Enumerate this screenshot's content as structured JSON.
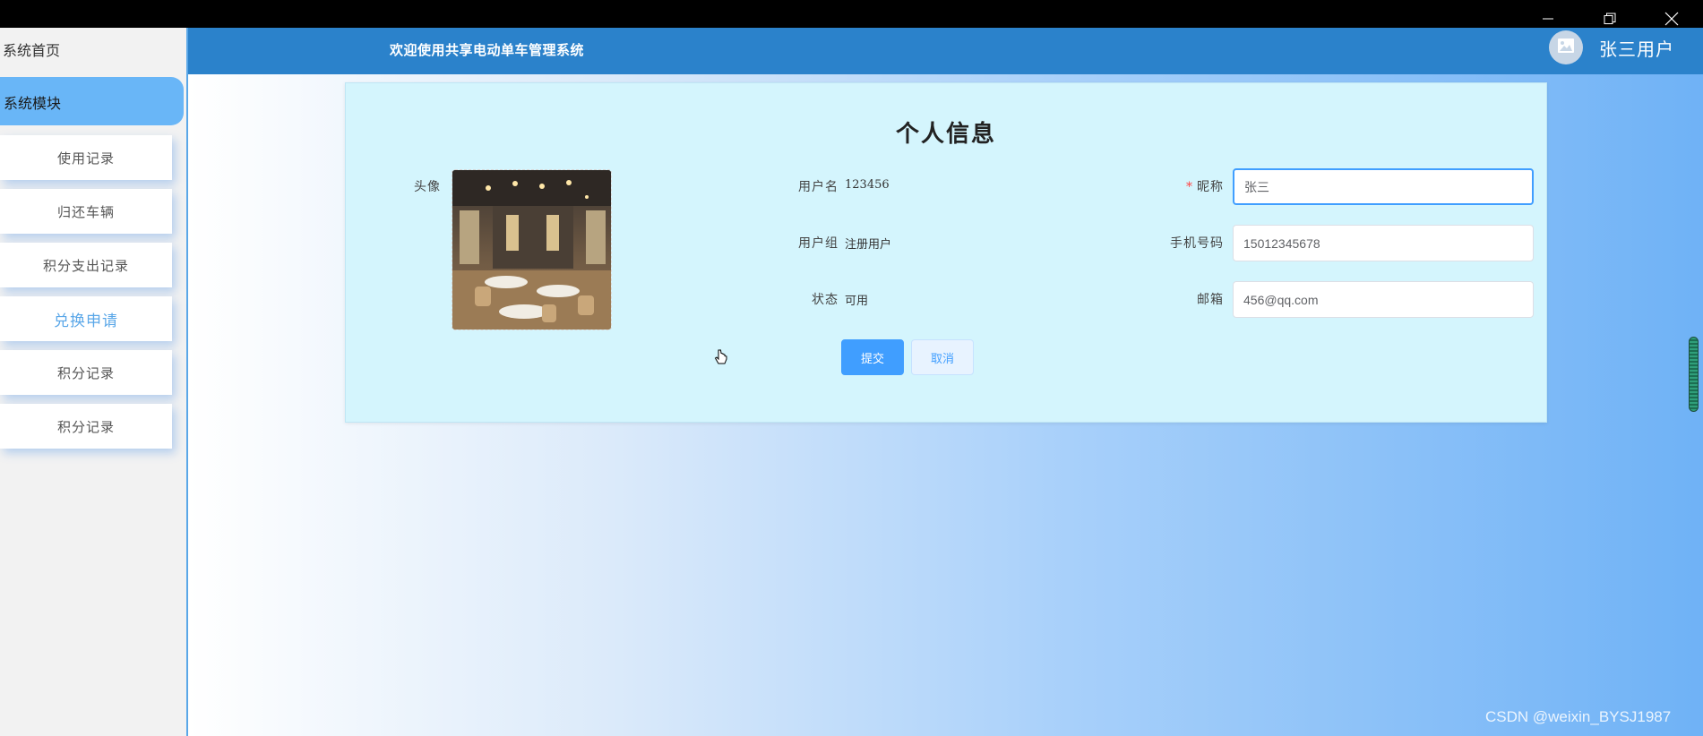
{
  "header": {
    "welcome": "欢迎使用共享电动单车管理系统",
    "username": "张三用户"
  },
  "sidebar": {
    "home": "系统首页",
    "module": "系统模块",
    "items": [
      {
        "label": "使用记录"
      },
      {
        "label": "归还车辆"
      },
      {
        "label": "积分支出记录"
      },
      {
        "label": "兑换申请"
      },
      {
        "label": "积分记录"
      },
      {
        "label": "积分记录"
      }
    ]
  },
  "form": {
    "title": "个人信息",
    "avatar_label": "头像",
    "username_label": "用户名",
    "username_value": "123456",
    "group_label": "用户组",
    "group_value": "注册用户",
    "status_label": "状态",
    "status_value": "可用",
    "nickname_label": "昵称",
    "nickname_value": "张三",
    "phone_label": "手机号码",
    "phone_value": "15012345678",
    "email_label": "邮箱",
    "email_value": "456@qq.com",
    "submit_label": "提交",
    "cancel_label": "取消"
  },
  "watermark": "CSDN @weixin_BYSJ1987",
  "colors": {
    "header": "#2b82cb",
    "sidebar_active": "#69b6f7",
    "card": "#d4f5fd",
    "primary": "#409eff"
  }
}
